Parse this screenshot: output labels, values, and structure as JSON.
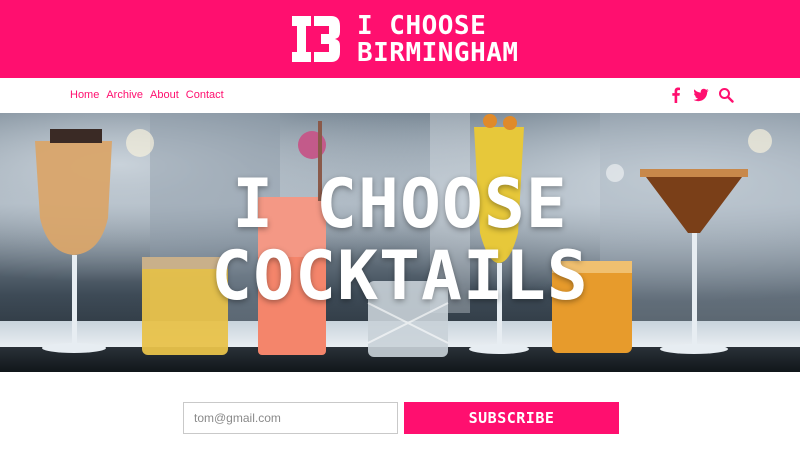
{
  "brand": {
    "line1": "I CHOOSE",
    "line2": "BIRMINGHAM",
    "color": "#ff0f6f"
  },
  "nav": {
    "items": [
      {
        "label": "Home"
      },
      {
        "label": "Archive"
      },
      {
        "label": "About"
      },
      {
        "label": "Contact"
      }
    ],
    "social_icons": [
      "facebook-icon",
      "twitter-icon",
      "search-icon"
    ]
  },
  "hero": {
    "line1": "I CHOOSE",
    "line2": "COCKTAILS"
  },
  "subscribe": {
    "email_placeholder": "tom@gmail.com",
    "button_label": "SUBSCRIBE"
  }
}
